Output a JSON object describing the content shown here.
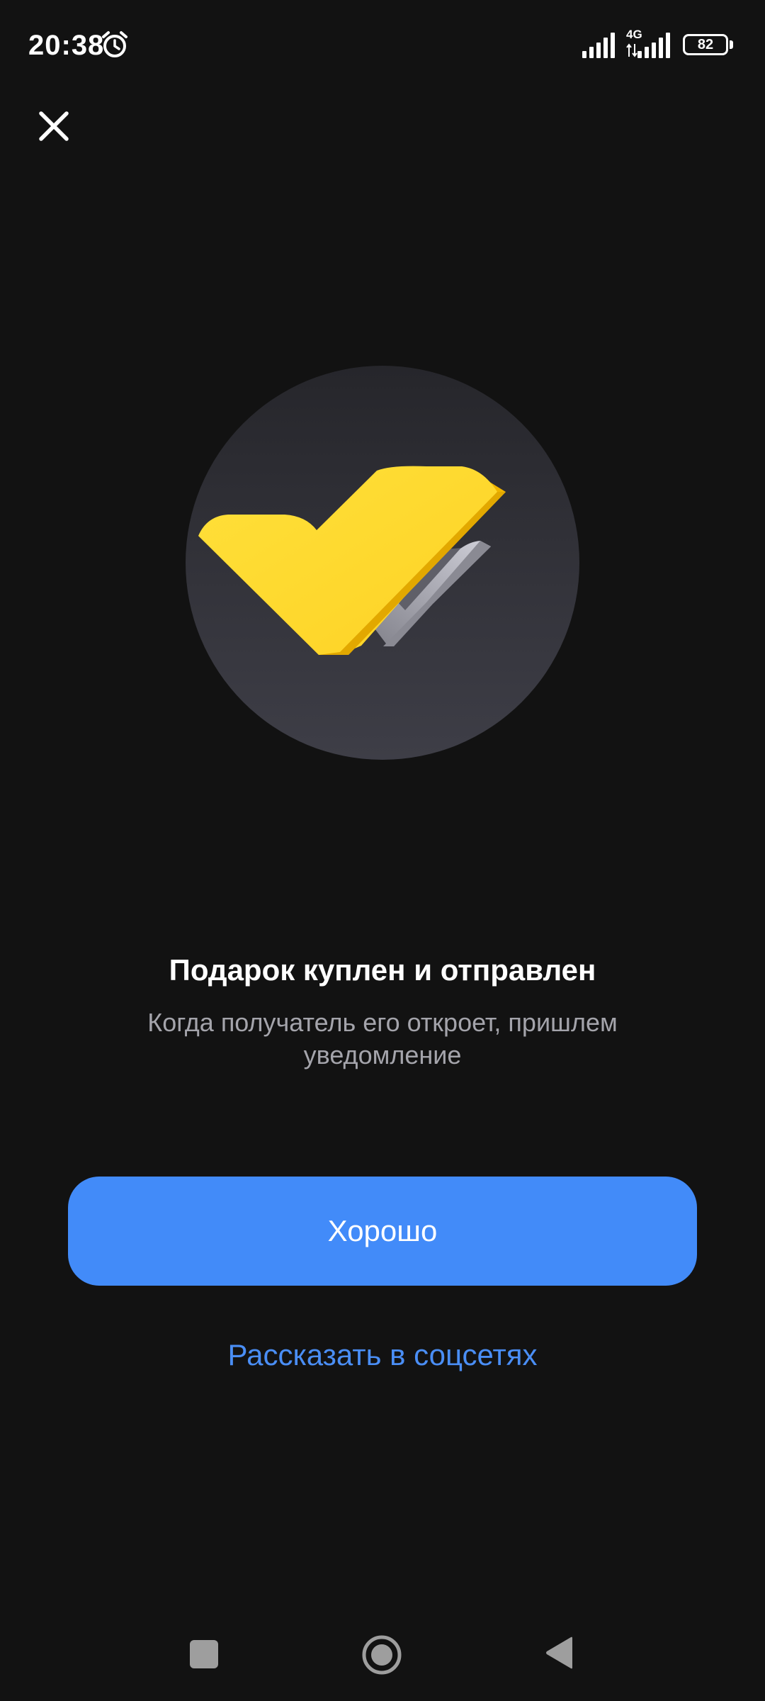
{
  "status_bar": {
    "time": "20:38",
    "network_type": "4G",
    "battery_level": "82",
    "icons": [
      "alarm-icon",
      "signal-icon",
      "signal-icon",
      "battery-icon"
    ]
  },
  "toolbar": {
    "close_icon": "close-icon"
  },
  "illustration": {
    "icon": "double-checkmark-icon",
    "colors": {
      "circle": "#2c2c33",
      "primary_check": "#ffd92c",
      "secondary_check": "#a7a7b0"
    }
  },
  "content": {
    "title": "Подарок куплен и отправлен",
    "subtitle": "Когда получатель его откроет, пришлем уведомление"
  },
  "actions": {
    "ok_label": "Хорошо",
    "share_label": "Рассказать в соцсетях",
    "accent_color": "#428bf9"
  },
  "nav_bar": {
    "icons": [
      "recent-apps-icon",
      "home-icon",
      "back-icon"
    ]
  }
}
